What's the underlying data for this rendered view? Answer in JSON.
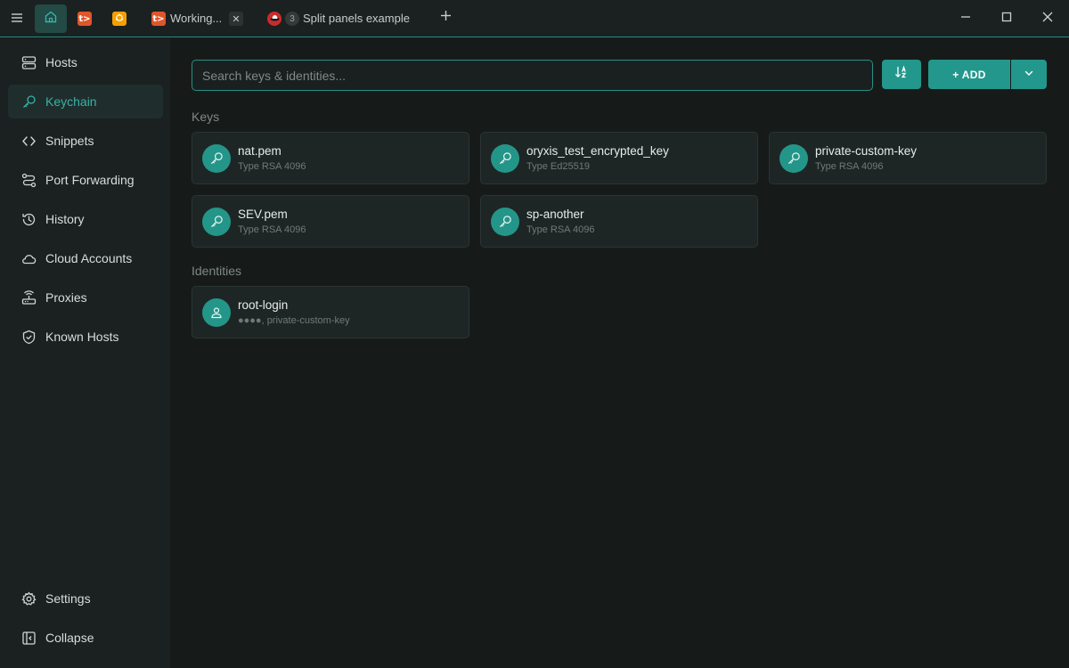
{
  "titlebar": {
    "tabs": [
      {
        "label": "",
        "icon": "home-icon"
      },
      {
        "label": "",
        "icon": "terminal-orange-icon",
        "color": "#e0562b"
      },
      {
        "label": "",
        "icon": "ubuntu-icon",
        "color": "#f5a000"
      },
      {
        "label": "Working...",
        "icon": "terminal-orange-icon",
        "color": "#e0562b"
      },
      {
        "label": "Split panels example",
        "icon": "redhat-icon",
        "color": "#cc2b2b",
        "count": "3"
      }
    ],
    "close_glyph": "✕",
    "add_glyph": "+"
  },
  "sidebar": {
    "items": [
      {
        "label": "Hosts",
        "icon": "server-icon",
        "active": false
      },
      {
        "label": "Keychain",
        "icon": "key-icon",
        "active": true
      },
      {
        "label": "Snippets",
        "icon": "code-icon",
        "active": false
      },
      {
        "label": "Port Forwarding",
        "icon": "port-forwarding-icon",
        "active": false
      },
      {
        "label": "History",
        "icon": "history-icon",
        "active": false
      },
      {
        "label": "Cloud Accounts",
        "icon": "cloud-icon",
        "active": false
      },
      {
        "label": "Proxies",
        "icon": "router-icon",
        "active": false
      },
      {
        "label": "Known Hosts",
        "icon": "shield-check-icon",
        "active": false
      }
    ],
    "bottom": [
      {
        "label": "Settings",
        "icon": "gear-icon"
      },
      {
        "label": "Collapse",
        "icon": "collapse-icon"
      }
    ]
  },
  "main": {
    "search_placeholder": "Search keys & identities...",
    "add_label": "+ ADD",
    "keys_title": "Keys",
    "identities_title": "Identities",
    "keys": [
      {
        "name": "nat.pem",
        "type": "Type RSA 4096"
      },
      {
        "name": "oryxis_test_encrypted_key",
        "type": "Type Ed25519"
      },
      {
        "name": "private-custom-key",
        "type": "Type RSA 4096"
      },
      {
        "name": "SEV.pem",
        "type": "Type RSA 4096"
      },
      {
        "name": "sp-another",
        "type": "Type RSA 4096"
      }
    ],
    "identities": [
      {
        "name": "root-login",
        "detail": "●●●●, private-custom-key"
      }
    ]
  },
  "colors": {
    "accent": "#23978c",
    "sidebar_bg": "#1b2120",
    "main_bg": "#161b1a",
    "card_bg": "#1e2625"
  }
}
